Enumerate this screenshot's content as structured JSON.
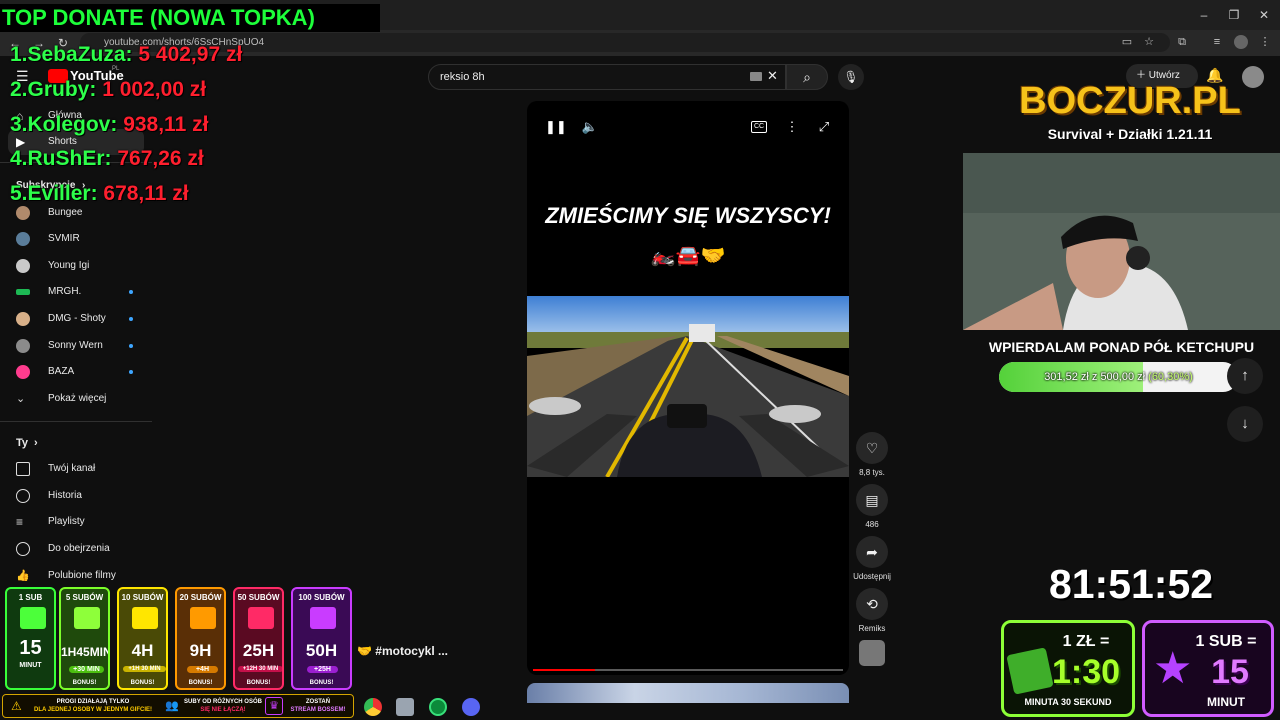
{
  "browser": {
    "url": "youtube.com/shorts/6SsCHnSpUO4",
    "window_controls": [
      "–",
      "❐",
      "✕"
    ]
  },
  "youtube": {
    "logo_text": "YouTube",
    "logo_region": "PL",
    "search_value": "reksio 8h",
    "create_label": "Utwórz",
    "sidebar": {
      "main": [
        {
          "label": "Główna",
          "icon": "home-icon"
        },
        {
          "label": "Shorts",
          "icon": "shorts-icon"
        }
      ],
      "subs_header": "Subskrypcje",
      "subscriptions": [
        {
          "label": "Bungee",
          "color": "#b08a6c",
          "new": false
        },
        {
          "label": "SVMIR",
          "color": "#5a7d9a",
          "new": false
        },
        {
          "label": "Young Igi",
          "color": "#c9c9c9",
          "new": false
        },
        {
          "label": "MRGH.",
          "color": "#1db954",
          "new": true
        },
        {
          "label": "DMG - Shoty",
          "color": "#d8b089",
          "new": true
        },
        {
          "label": "Sonny Wern",
          "color": "#8b8b8b",
          "new": true
        },
        {
          "label": "BAZA",
          "color": "#ff3c8e",
          "new": true
        }
      ],
      "show_more": "Pokaż więcej",
      "you_header": "Ty",
      "you_items": [
        {
          "label": "Twój kanał",
          "icon": "user-icon"
        },
        {
          "label": "Historia",
          "icon": "history-icon"
        },
        {
          "label": "Playlisty",
          "icon": "playlist-icon"
        },
        {
          "label": "Do obejrzenia",
          "icon": "clock-icon"
        },
        {
          "label": "Polubione filmy",
          "icon": "like-icon"
        }
      ]
    },
    "short": {
      "title_overlay": "ZMIEŚCIMY SIĘ WSZYSCY!",
      "emoji": "🏍️🚘🤝",
      "title": "#motocykl ...",
      "title_emoji": "🤝",
      "progress": 0.2,
      "likes": "8,8 tys.",
      "comments": "486",
      "share_label": "Udostępnij",
      "remix_label": "Remiks"
    }
  },
  "overlay": {
    "donate_title": "TOP DONATE (NOWA TOPKA)",
    "donors": [
      {
        "rank": "1.",
        "name": "SebaZuza",
        "amount": "5 402,97 zł"
      },
      {
        "rank": "2.",
        "name": "Gruby",
        "amount": "1 002,00 zł"
      },
      {
        "rank": "3.",
        "name": "Kolegov",
        "amount": "938,11 zł"
      },
      {
        "rank": "4.",
        "name": "RuShEr",
        "amount": "767,26 zł"
      },
      {
        "rank": "5.",
        "name": "Eviller",
        "amount": "678,11 zł"
      }
    ],
    "logo_title": "BOCZUR.PL",
    "logo_sub": "Survival + Działki 1.21.11",
    "goal_title": "WPIERDALAM PONAD PÓŁ KETCHUPU",
    "goal_text": "301,52 zł z 500,00 zł",
    "goal_pct_text": "(60,30%)",
    "goal_fraction": 0.603,
    "timer": "81:51:52",
    "card_zl": {
      "top": "1 ZŁ =",
      "big": "1:30",
      "bottom": "MINUTA 30 SEKUND"
    },
    "card_sub": {
      "top": "1 SUB =",
      "big": "15",
      "bottom": "MINUT"
    },
    "sub_tiers": [
      {
        "title": "1 SUB",
        "value": "15",
        "bonus": "MINUT",
        "color": "#0f5a0f",
        "border": "#39ff3a"
      },
      {
        "title": "5 SUBÓW",
        "value": "1H45MIN",
        "bonus": "+30 MIN",
        "note": "BONUS!",
        "color": "#1f6b0c",
        "border": "#7cff2a"
      },
      {
        "title": "10 SUBÓW",
        "value": "4H",
        "bonus": "+1H 30 MIN",
        "note": "BONUS!",
        "color": "#6b6b06",
        "border": "#ffe600"
      },
      {
        "title": "20 SUBÓW",
        "value": "9H",
        "bonus": "+4H",
        "note": "BONUS!",
        "color": "#7a3f06",
        "border": "#ff9a00"
      },
      {
        "title": "50 SUBÓW",
        "value": "25H",
        "bonus": "+12H 30 MIN",
        "note": "BONUS!",
        "color": "#7a0a2a",
        "border": "#ff2a66"
      },
      {
        "title": "100 SUBÓW",
        "value": "50H",
        "bonus": "+25H",
        "note": "BONUS!",
        "color": "#4a0a6b",
        "border": "#c93cff"
      }
    ],
    "rules": [
      {
        "line1": "PROGI DZIAŁAJĄ TYLKO",
        "line2": "DLA JEDNEJ OSOBY W JEDNYM GIFCIE!"
      },
      {
        "line1": "SUBY OD RÓŻNYCH OSÓB",
        "line2": "SIĘ NIE ŁĄCZĄ!"
      },
      {
        "line1": "ZOSTAŃ",
        "line2": "STREAM BOSSEM!"
      }
    ]
  }
}
